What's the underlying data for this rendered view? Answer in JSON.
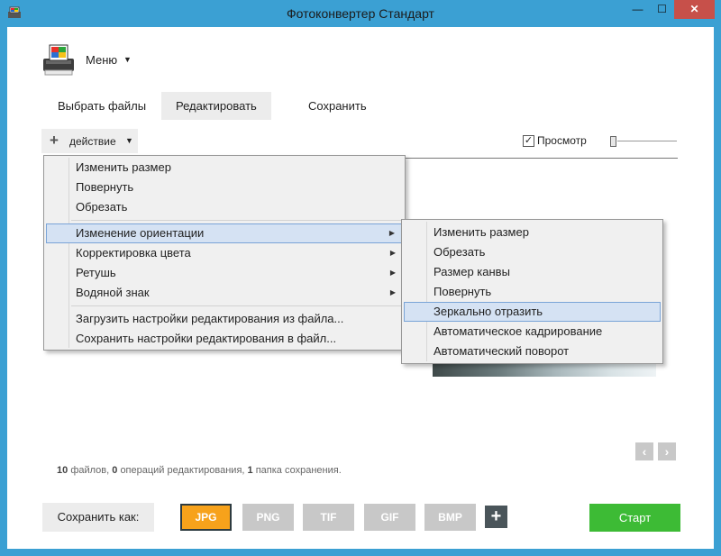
{
  "window": {
    "title": "Фотоконвертер Стандарт",
    "minimize": "—",
    "maximize": "☐",
    "close": "✕"
  },
  "app_menu": {
    "label": "Меню"
  },
  "tabs": [
    {
      "label": "Выбрать файлы",
      "active": false
    },
    {
      "label": "Редактировать",
      "active": true
    },
    {
      "label": "Сохранить",
      "active": false
    }
  ],
  "action": {
    "label": "действие"
  },
  "preview": {
    "label": "Просмотр",
    "checked": true
  },
  "main_menu": {
    "group1": [
      "Изменить размер",
      "Повернуть",
      "Обрезать"
    ],
    "group2": [
      "Изменение ориентации",
      "Корректировка цвета",
      "Ретушь",
      "Водяной знак"
    ],
    "group3": [
      "Загрузить настройки редактирования из файла...",
      "Сохранить настройки редактирования в файл..."
    ],
    "highlighted": "Изменение ориентации"
  },
  "sub_menu": {
    "items": [
      "Изменить размер",
      "Обрезать",
      "Размер канвы",
      "Повернуть",
      "Зеркально отразить",
      "Автоматическое кадрирование",
      "Автоматический поворот"
    ],
    "highlighted": "Зеркально отразить"
  },
  "status": {
    "files_count": "10",
    "files_text": "файлов,",
    "ops_count": "0",
    "ops_text": "операций редактирования,",
    "folders_count": "1",
    "folders_text": "папка сохранения."
  },
  "save_as": {
    "label": "Сохранить как:"
  },
  "formats": [
    {
      "label": "JPG",
      "active": true
    },
    {
      "label": "PNG",
      "active": false
    },
    {
      "label": "TIF",
      "active": false
    },
    {
      "label": "GIF",
      "active": false
    },
    {
      "label": "BMP",
      "active": false
    }
  ],
  "add_format": "+",
  "start": {
    "label": "Старт"
  },
  "colors": {
    "accent_title": "#3ba0d3",
    "active_format": "#f7a21b",
    "start_button": "#3dbb35",
    "menu_highlight": "#d5e2f3"
  }
}
